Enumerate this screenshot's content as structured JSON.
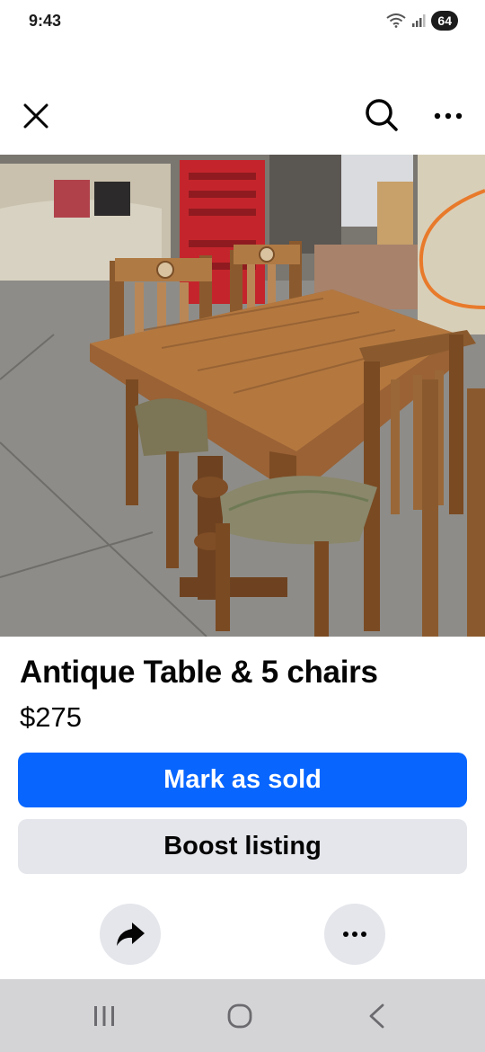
{
  "status_bar": {
    "time": "9:43",
    "battery": "64"
  },
  "top_bar": {
    "close_icon": "close-icon",
    "search_icon": "search-icon",
    "more_icon": "more-icon"
  },
  "photo": {
    "carousel_count": 5,
    "carousel_active_index": 3
  },
  "listing": {
    "title": "Antique Table & 5 chairs",
    "price": "$275"
  },
  "actions": {
    "mark_sold_label": "Mark as sold",
    "boost_label": "Boost listing",
    "share_icon": "share-icon",
    "more_icon": "more-icon"
  },
  "nav": {
    "recent_icon": "recent-apps-icon",
    "home_icon": "home-icon",
    "back_icon": "back-icon"
  },
  "colors": {
    "primary": "#0866ff",
    "secondary": "#e4e6eb",
    "nav_bar": "#d4d4d6",
    "text": "#050505"
  }
}
